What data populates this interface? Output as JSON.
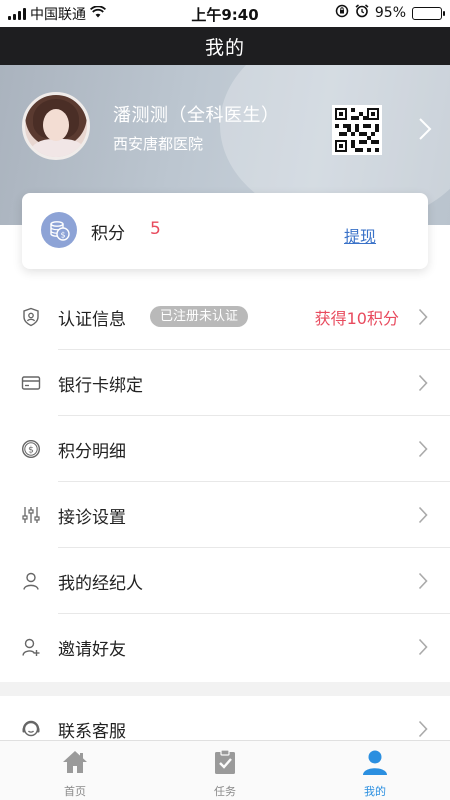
{
  "status_bar": {
    "carrier": "中国联通",
    "time": "上午9:40",
    "battery_percent": "95%",
    "battery_level": 0.95,
    "icons": [
      "signal-icon",
      "wifi-icon",
      "lock-rotation-icon",
      "alarm-icon",
      "battery-icon"
    ]
  },
  "header": {
    "title": "我的"
  },
  "profile": {
    "name": "潘测测（全科医生）",
    "hospital": "西安唐都医院"
  },
  "points": {
    "label": "积分",
    "value": "5",
    "withdraw_label": "提现"
  },
  "menu": {
    "certification": {
      "label": "认证信息",
      "badge": "已注册未认证",
      "reward": "获得10积分"
    },
    "bank_card": {
      "label": "银行卡绑定"
    },
    "points_detail": {
      "label": "积分明细"
    },
    "consult_settings": {
      "label": "接诊设置"
    },
    "my_agent": {
      "label": "我的经纪人"
    },
    "invite_friends": {
      "label": "邀请好友"
    },
    "customer_service": {
      "label": "联系客服"
    }
  },
  "tabs": [
    {
      "label": "首页",
      "icon": "home-icon",
      "active": false
    },
    {
      "label": "任务",
      "icon": "clipboard-check-icon",
      "active": false
    },
    {
      "label": "我的",
      "icon": "user-icon",
      "active": true
    }
  ],
  "colors": {
    "accent_red": "#e84b5e",
    "link_blue": "#3a72c8",
    "tab_active": "#2b8fe0",
    "nav_bg": "#1e1e20"
  }
}
